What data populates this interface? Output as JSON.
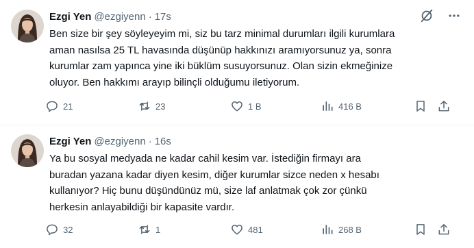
{
  "tweets": [
    {
      "author_name": "Ezgi Yen",
      "handle": "@ezgiyenn",
      "separator": "·",
      "time": "17s",
      "text_lines": [
        "Ben size bir şey söyleyeyim mi, siz bu tarz minimal durumları ilgili kurumlara",
        "aman nasılsa 25 TL  havasında düşünüp hakkınızı aramıyorsunuz ya, sonra",
        "kurumlar zam yapınca yine iki büklüm susuyorsunuz. Olan sizin ekmeğinize",
        "oluyor. Ben hakkımı arayıp bilinçli olduğumu iletiyorum."
      ],
      "stats": {
        "replies": "21",
        "reposts": "23",
        "likes": "1 B",
        "views": "416 B"
      }
    },
    {
      "author_name": "Ezgi Yen",
      "handle": "@ezgiyenn",
      "separator": "·",
      "time": "16s",
      "text_lines": [
        "Ya bu sosyal medyada ne kadar cahil kesim var. İstediğin firmayı ara",
        "buradan yazana kadar diyen kesim, diğer kurumlar sizce neden x hesabı",
        "kullanıyor? Hiç bunu düşündünüz mü, size laf anlatmak çok zor çünkü",
        "herkesin anlayabildiği bir kapasite vardır."
      ],
      "stats": {
        "replies": "32",
        "reposts": "1",
        "likes": "481",
        "views": "268 B"
      }
    }
  ],
  "icons": {
    "reply": "speech-bubble-icon",
    "repost": "retweet-arrows-icon",
    "like": "heart-icon",
    "views": "bar-chart-icon",
    "bookmark": "bookmark-icon",
    "share": "share-arrow-icon",
    "grok": "grok-slash-circle-icon",
    "more": "more-dots-icon"
  },
  "colors": {
    "text_primary": "#0f1419",
    "text_secondary": "#536471",
    "divider": "#eff3f4"
  }
}
